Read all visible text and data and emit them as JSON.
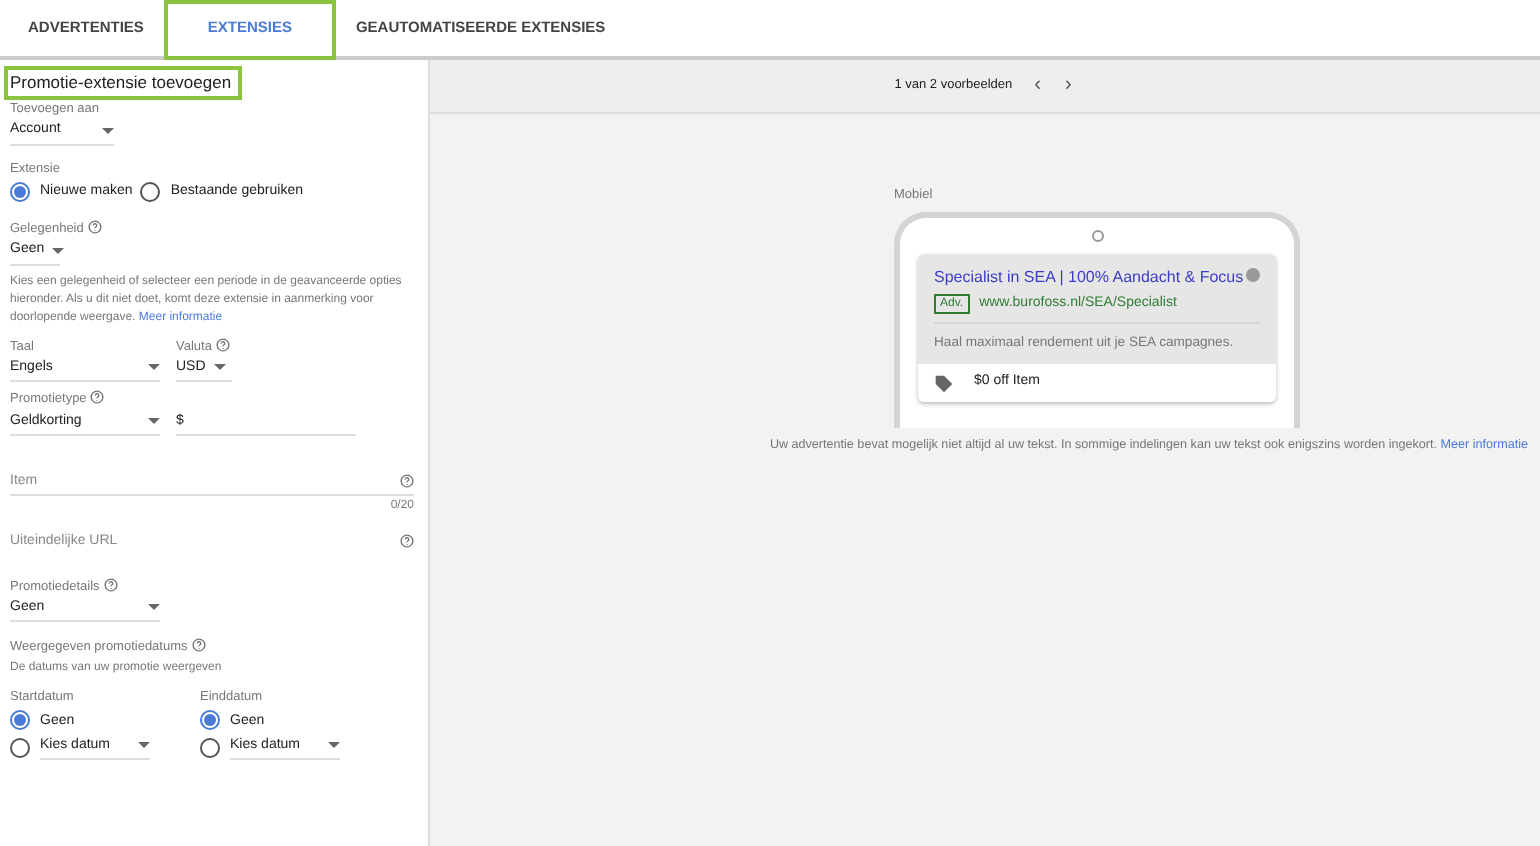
{
  "tabs": [
    {
      "label": "ADVERTENTIES",
      "selected": false,
      "highlighted": false
    },
    {
      "label": "EXTENSIES",
      "selected": true,
      "highlighted": true
    },
    {
      "label": "GEAUTOMATISEERDE EXTENSIES",
      "selected": false,
      "highlighted": false
    }
  ],
  "form": {
    "title": "Promotie-extensie toevoegen",
    "title_highlighted": true,
    "add_to": {
      "label": "Toevoegen aan",
      "value": "Account"
    },
    "extension": {
      "label": "Extensie",
      "options": [
        {
          "label": "Nieuwe maken",
          "selected": true
        },
        {
          "label": "Bestaande gebruiken",
          "selected": false
        }
      ]
    },
    "occasion": {
      "label": "Gelegenheid",
      "value": "Geen",
      "help": "Kies een gelegenheid of selecteer een periode in de geavanceerde opties hieronder. Als u dit niet doet, komt deze extensie in aanmerking voor doorlopende weergave.",
      "link": "Meer informatie"
    },
    "language": {
      "label": "Taal",
      "value": "Engels"
    },
    "currency": {
      "label": "Valuta",
      "value": "USD"
    },
    "promo_type": {
      "label": "Promotietype",
      "value": "Geldkorting",
      "amount_prefix": "$"
    },
    "item": {
      "placeholder": "Item",
      "counter": "0/20"
    },
    "final_url": {
      "placeholder": "Uiteindelijke URL"
    },
    "promo_details": {
      "label": "Promotiedetails",
      "value": "Geen"
    },
    "dates": {
      "label": "Weergegeven promotiedatums",
      "sub": "De datums van uw promotie weergeven",
      "columns": [
        {
          "label": "Startdatum",
          "options": [
            {
              "label": "Geen",
              "selected": true,
              "kind": "plain"
            },
            {
              "label": "Kies datum",
              "selected": false,
              "kind": "dropdown"
            }
          ]
        },
        {
          "label": "Einddatum",
          "options": [
            {
              "label": "Geen",
              "selected": true,
              "kind": "plain"
            },
            {
              "label": "Kies datum",
              "selected": false,
              "kind": "dropdown"
            }
          ]
        }
      ]
    }
  },
  "preview": {
    "pager": "1 van 2 voorbeelden",
    "prev": "‹",
    "next": "›",
    "device": "Mobiel",
    "ad": {
      "headline": "Specialist in SEA | 100% Aandacht & Focus",
      "badge": "Adv.",
      "url": "www.burofoss.nl/SEA/Specialist",
      "description": "Haal maximaal rendement uit je SEA campagnes.",
      "promo": "$0 off Item"
    },
    "note": "Uw advertentie bevat mogelijk niet altijd al uw tekst. In sommige indelingen kan uw tekst ook enigszins worden ingekort.",
    "note_link": "Meer informatie"
  }
}
